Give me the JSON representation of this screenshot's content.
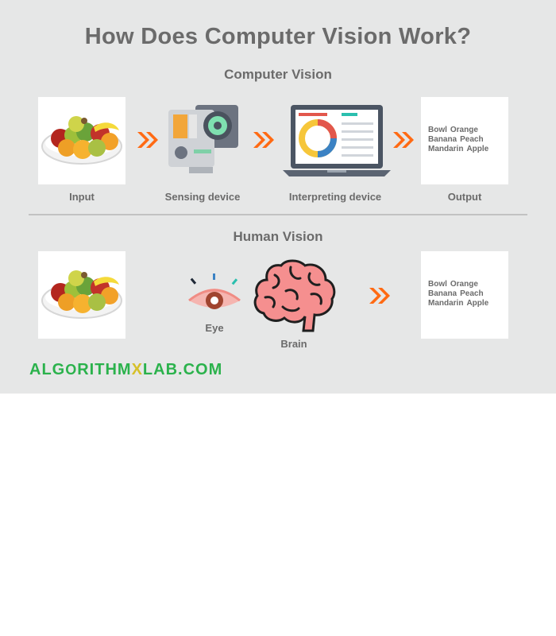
{
  "title": "How Does Computer Vision Work?",
  "computer_vision": {
    "heading": "Computer Vision",
    "captions": {
      "input": "Input",
      "sensing": "Sensing device",
      "interpreting": "Interpreting device",
      "output": "Output"
    },
    "output_items": [
      "Bowl",
      "Orange",
      "Banana",
      "Peach",
      "Mandarin",
      "Apple"
    ]
  },
  "human_vision": {
    "heading": "Human Vision",
    "captions": {
      "eye": "Eye",
      "brain": "Brain"
    },
    "output_items": [
      "Bowl",
      "Orange",
      "Banana",
      "Peach",
      "Mandarin",
      "Apple"
    ]
  },
  "logo": {
    "part1": "ALG",
    "part2": "O",
    "part3": "RITHM",
    "part4": "X",
    "part5": "LAB.COM"
  },
  "colors": {
    "background": "#e6e7e7",
    "text": "#6b6b6b",
    "arrow": "#ff6a13",
    "logo_green": "#2bb24c",
    "logo_yellow": "#d6c02a"
  },
  "icons": {
    "arrow": "chevron-double-right-icon",
    "fruit": "fruit-bowl-icon",
    "camera": "camera-icon",
    "laptop": "laptop-chart-icon",
    "eye": "eye-icon",
    "brain": "brain-icon"
  }
}
